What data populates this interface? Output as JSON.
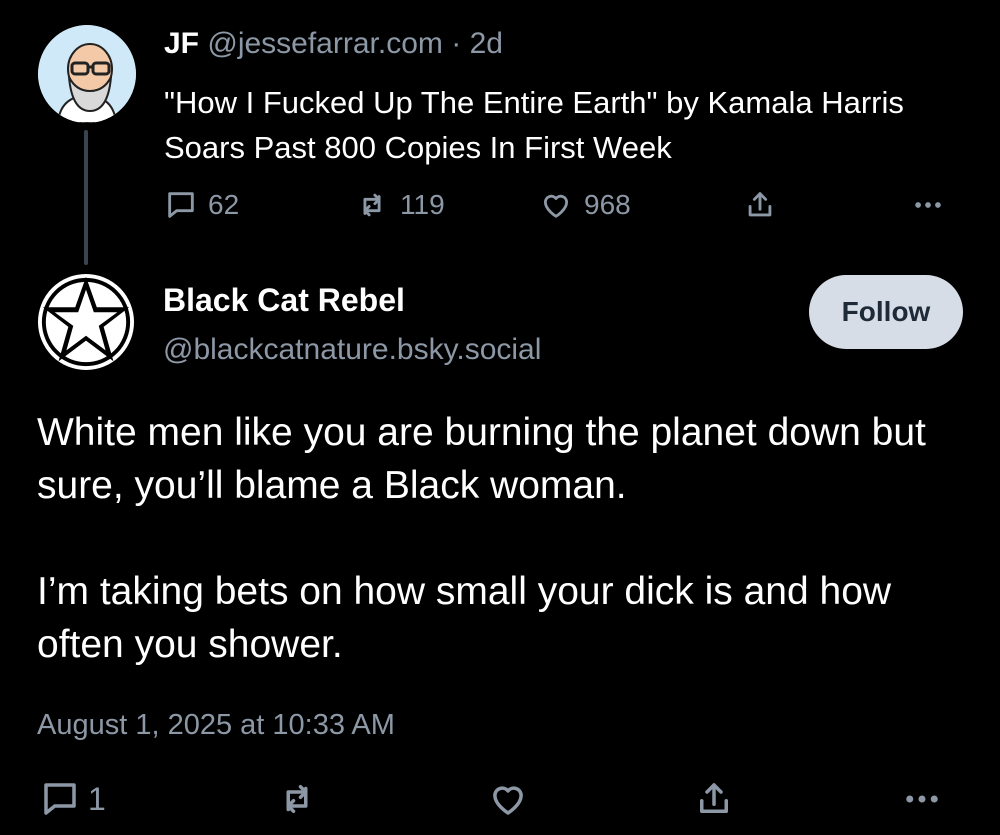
{
  "parent_post": {
    "author_name": "JF",
    "author_handle": "@jessefarrar.com",
    "separator": "·",
    "age": "2d",
    "text": "\"How I Fucked Up The Entire Earth\" by Kamala Harris Soars Past 800 Copies In First Week",
    "replies": "62",
    "reposts": "119",
    "likes": "968"
  },
  "reply_post": {
    "author_name": "Black Cat Rebel",
    "author_handle": "@blackcatnature.bsky.social",
    "follow_label": "Follow",
    "paragraphs": [
      "White men like you are burning the planet down but sure, you’ll blame a Black woman.",
      "I’m taking bets on how small your dick is and how often you shower."
    ],
    "timestamp": "August 1, 2025 at 10:33 AM",
    "replies": "1"
  },
  "icons": {
    "reply": "reply-icon",
    "repost": "repost-icon",
    "like": "heart-icon",
    "share": "share-icon",
    "more": "more-icon"
  },
  "colors": {
    "background": "#000000",
    "text": "#ffffff",
    "muted": "#8d98a6",
    "follow_button_bg": "#d6dde6",
    "follow_button_text": "#1e2a38",
    "thread_line": "#3a4350"
  }
}
